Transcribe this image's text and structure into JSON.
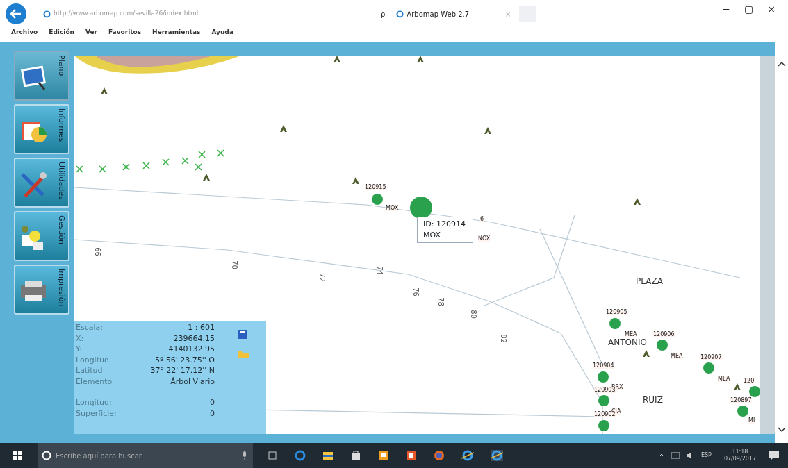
{
  "browser": {
    "url": "http://www.arbomap.com/sevilla26/index.html",
    "search_symbol": "ρ",
    "tab_title": "Arbomap Web 2.7",
    "tab_close": "×"
  },
  "window_controls": [
    "−",
    "▢",
    "×"
  ],
  "menu": [
    "Archivo",
    "Edición",
    "Ver",
    "Favoritos",
    "Herramientas",
    "Ayuda"
  ],
  "sidebar": {
    "items": [
      {
        "label": "Plano",
        "selected": true
      },
      {
        "label": "Informes",
        "selected": false
      },
      {
        "label": "Utilidades",
        "selected": false
      },
      {
        "label": "Gestión",
        "selected": false
      },
      {
        "label": "Impresión",
        "selected": false
      }
    ]
  },
  "map": {
    "trees": [
      {
        "id": "120915",
        "species": "MOX",
        "kind": "small"
      },
      {
        "kind": "large"
      },
      {
        "id": "120905",
        "species": "MEA",
        "kind": "small"
      },
      {
        "id": "120906",
        "species": "MEA",
        "kind": "small"
      },
      {
        "id": "120907",
        "species": "MEA",
        "kind": "small"
      },
      {
        "id": "120904",
        "species": "BRX",
        "kind": "small"
      },
      {
        "id": "120903",
        "species": "CIA",
        "kind": "small"
      },
      {
        "id": "120902",
        "kind": "small"
      },
      {
        "id": "120",
        "kind": "small"
      },
      {
        "id": "120897",
        "species": "MI",
        "kind": "small"
      }
    ],
    "partial_labels": [
      "6",
      "NOX"
    ],
    "street_labels": [
      "PLAZA",
      "ANTONIO",
      "RUIZ"
    ],
    "house_numbers": [
      "66",
      "70",
      "72",
      "74",
      "76",
      "78",
      "80",
      "82"
    ],
    "tooltip": {
      "lines": [
        "ID: 120914",
        "MOX"
      ]
    }
  },
  "info_panel": {
    "rows": [
      {
        "label": "Escala:",
        "value": "1 : 601"
      },
      {
        "label": "X:",
        "value": "239664.15"
      },
      {
        "label": "Y:",
        "value": "4140132.95"
      },
      {
        "label": "Longitud",
        "value": "5º 56' 23.75'' O"
      },
      {
        "label": "Latitud",
        "value": "37º 22' 17.12'' N"
      },
      {
        "label": "Elemento",
        "value": "Árbol Viario"
      },
      {
        "label": "Longitud:",
        "value": "0",
        "gap_before": true
      },
      {
        "label": "Superficie:",
        "value": "0"
      }
    ]
  },
  "taskbar": {
    "search_placeholder": "Escribe aquí para buscar",
    "language": "ESP",
    "time": "11:18",
    "date": "07/09/2017"
  }
}
